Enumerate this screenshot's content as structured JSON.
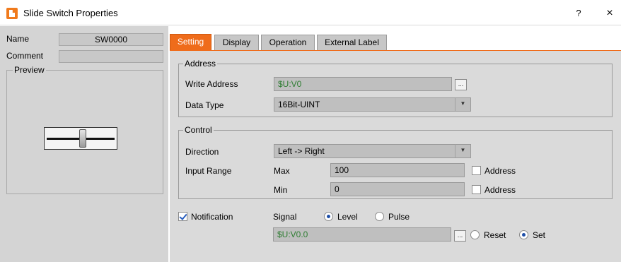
{
  "window": {
    "title": "Slide Switch Properties",
    "help_label": "?",
    "close_label": "×"
  },
  "left": {
    "name_label": "Name",
    "name_value": "SW0000",
    "comment_label": "Comment",
    "comment_value": "",
    "preview_label": "Preview"
  },
  "tabs": [
    {
      "label": "Setting",
      "active": true
    },
    {
      "label": "Display",
      "active": false
    },
    {
      "label": "Operation",
      "active": false
    },
    {
      "label": "External Label",
      "active": false
    }
  ],
  "address": {
    "legend": "Address",
    "write_label": "Write Address",
    "write_value": "$U:V0",
    "write_btn": "...",
    "type_label": "Data Type",
    "type_value": "16Bit-UINT"
  },
  "control": {
    "legend": "Control",
    "direction_label": "Direction",
    "direction_value": "Left -> Right",
    "range_label": "Input Range",
    "max_label": "Max",
    "max_value": "100",
    "min_label": "Min",
    "min_value": "0",
    "max_address_label": "Address",
    "min_address_label": "Address",
    "max_address_checked": false,
    "min_address_checked": false
  },
  "notification": {
    "label": "Notification",
    "checked": true,
    "signal_label": "Signal",
    "level_label": "Level",
    "pulse_label": "Pulse",
    "signal_selected": "Level",
    "address_value": "$U:V0.0",
    "address_btn": "...",
    "reset_label": "Reset",
    "set_label": "Set",
    "action_selected": "Set"
  },
  "colors": {
    "accent": "#ef6c1b",
    "address_text": "#2e7d32",
    "panel": "#dadada",
    "left_panel": "#d4d4d4"
  }
}
